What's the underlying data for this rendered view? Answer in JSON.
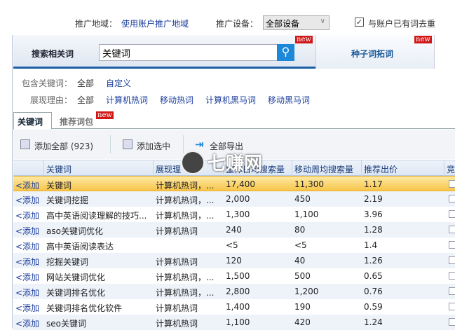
{
  "filters": {
    "region_label": "推广地域：",
    "region_value": "使用账户推广地域",
    "device_label": "推广设备：",
    "device_value": "全部设备",
    "dedupe_checked": true,
    "dedupe_label": "与账户已有词去重"
  },
  "search": {
    "tab_label": "搜索相关词",
    "input_value": "关键词",
    "new_badge": "new",
    "seed_tab": "种子词拓词",
    "seed_new": "new"
  },
  "include": {
    "label": "包含关键词：",
    "options": [
      "全部",
      "自定义"
    ]
  },
  "reason": {
    "label": "展现理由：",
    "options": [
      "全部",
      "计算机热词",
      "移动热词",
      "计算机黑马词",
      "移动黑马词"
    ]
  },
  "tabs": [
    {
      "label": "关键词",
      "active": true
    },
    {
      "label": "推荐词包",
      "badge": "new"
    }
  ],
  "toolbar": {
    "add_all": "添加全部 (923)",
    "add_selected": "添加选中",
    "export_all": "全部导出"
  },
  "table": {
    "headers": [
      "",
      "关键词",
      "展现理",
      "整体日均搜索量",
      "移动周均搜索量",
      "推荐出价",
      "竞"
    ],
    "add_label": "<添加",
    "rows": [
      [
        "关键词",
        "计算机热词，...",
        "17,400",
        "11,300",
        "1.17"
      ],
      [
        "关键词挖掘",
        "计算机热词，...",
        "2,000",
        "450",
        "2.19"
      ],
      [
        "高中英语阅读理解的技巧...",
        "计算机热词，...",
        "1,300",
        "1,100",
        "3.96"
      ],
      [
        "aso关键词优化",
        "计算机热词",
        "240",
        "80",
        "1.28"
      ],
      [
        "高中英语阅读表达",
        "",
        "<5",
        "<5",
        "1.4"
      ],
      [
        "挖掘关键词",
        "计算机热词",
        "120",
        "40",
        "1.26"
      ],
      [
        "网站关键词优化",
        "计算机热词，...",
        "1,500",
        "500",
        "0.65"
      ],
      [
        "关键词排名优化",
        "计算机热词，...",
        "2,800",
        "1,200",
        "0.76"
      ],
      [
        "关键词排名优化软件",
        "计算机热词",
        "1,400",
        "190",
        "0.59"
      ],
      [
        "seo关键词",
        "计算机热词",
        "1,100",
        "420",
        "1.24"
      ]
    ]
  },
  "watermark": "七赚网",
  "colors": {
    "accent": "#1c5fa8",
    "selected_row": "#f8c54a",
    "new_badge": "#d01818"
  }
}
